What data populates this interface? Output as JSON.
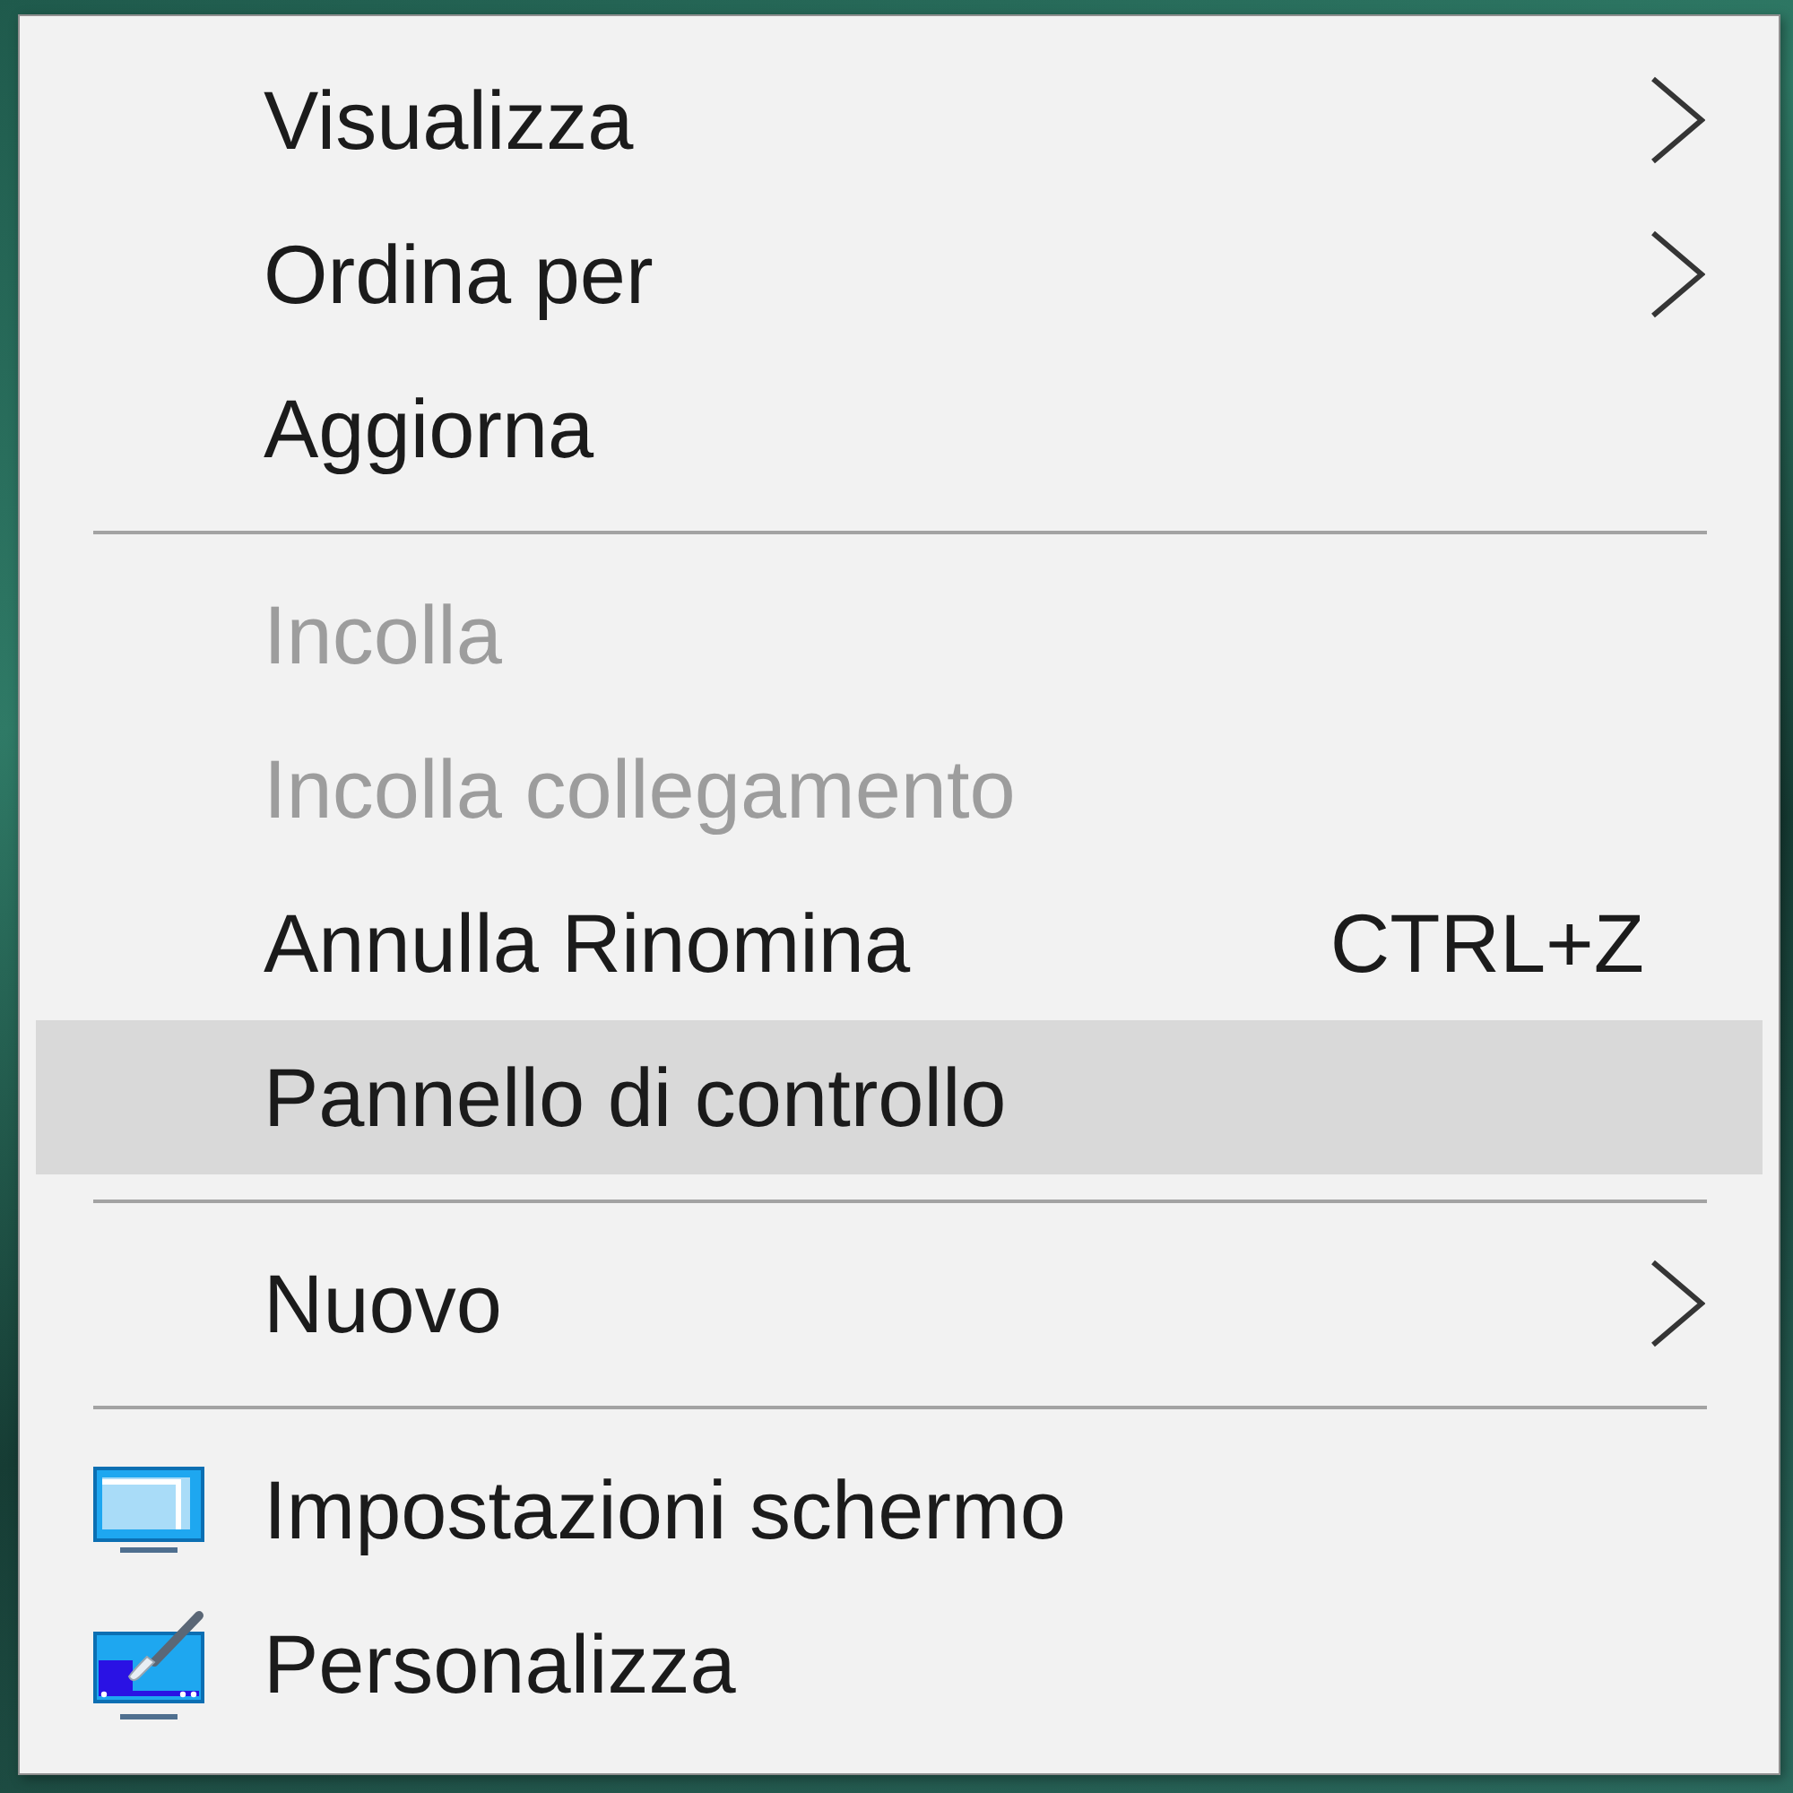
{
  "context_menu": {
    "sections": [
      {
        "items": [
          {
            "kind": "text",
            "label": "Visualizza",
            "has_submenu": true,
            "disabled": false,
            "selected": false
          },
          {
            "kind": "text",
            "label": "Ordina per",
            "has_submenu": true,
            "disabled": false,
            "selected": false
          },
          {
            "kind": "text",
            "label": "Aggiorna",
            "has_submenu": false,
            "disabled": false,
            "selected": false
          }
        ]
      },
      {
        "items": [
          {
            "kind": "text",
            "label": "Incolla",
            "has_submenu": false,
            "disabled": true,
            "selected": false
          },
          {
            "kind": "text",
            "label": "Incolla collegamento",
            "has_submenu": false,
            "disabled": true,
            "selected": false
          },
          {
            "kind": "text",
            "label": "Annulla Rinomina",
            "shortcut": "CTRL+Z",
            "has_submenu": false,
            "disabled": false,
            "selected": false
          },
          {
            "kind": "text",
            "label": "Pannello di controllo",
            "has_submenu": false,
            "disabled": false,
            "selected": true
          }
        ]
      },
      {
        "items": [
          {
            "kind": "text",
            "label": "Nuovo",
            "has_submenu": true,
            "disabled": false,
            "selected": false
          }
        ]
      },
      {
        "items": [
          {
            "kind": "display",
            "label": "Impostazioni schermo",
            "has_submenu": false,
            "disabled": false,
            "selected": false
          },
          {
            "kind": "personalize",
            "label": "Personalizza",
            "has_submenu": false,
            "disabled": false,
            "selected": false
          }
        ]
      }
    ]
  }
}
